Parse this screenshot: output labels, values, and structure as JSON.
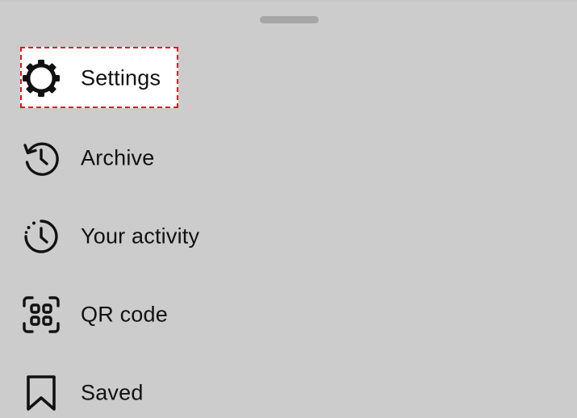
{
  "menu": {
    "items": [
      {
        "label": "Settings",
        "icon": "gear-icon",
        "highlighted": true
      },
      {
        "label": "Archive",
        "icon": "archive-history-icon"
      },
      {
        "label": "Your activity",
        "icon": "activity-clock-icon"
      },
      {
        "label": "QR code",
        "icon": "qr-code-icon"
      },
      {
        "label": "Saved",
        "icon": "bookmark-icon"
      }
    ]
  },
  "colors": {
    "background": "#cccccc",
    "highlight_fill": "#ffffff",
    "highlight_border": "#e8101a",
    "text": "#111111",
    "handle": "#a6a6a6"
  }
}
